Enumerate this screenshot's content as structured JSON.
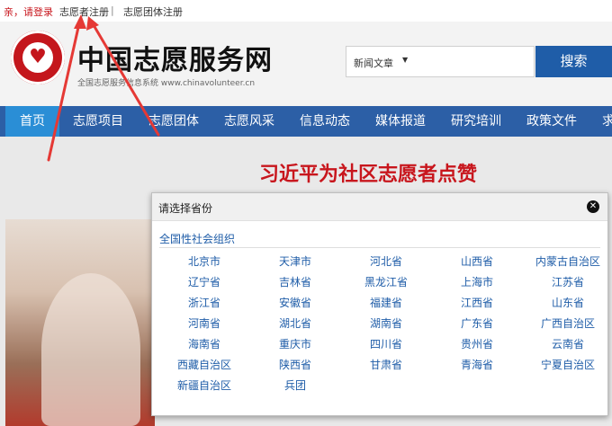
{
  "topbar": {
    "login_text": "亲，请登录",
    "volunteer_register": "志愿者注册",
    "separator": "|",
    "group_register": "志愿团体注册"
  },
  "header": {
    "site_title": "中国志愿服务网",
    "site_subtitle": "全国志愿服务信息系统 www.chinavolunteer.cn",
    "search_category": "新闻文章",
    "search_button": "搜索"
  },
  "nav": {
    "items": [
      "首页",
      "志愿项目",
      "志愿团体",
      "志愿风采",
      "信息动态",
      "媒体报道",
      "研究培训",
      "政策文件",
      "求"
    ]
  },
  "main": {
    "headline": "习近平为社区志愿者点赞"
  },
  "modal": {
    "title": "请选择省份",
    "national_link": "全国性社会组织",
    "provinces": [
      [
        "北京市",
        "天津市",
        "河北省",
        "山西省",
        "内蒙古自治区"
      ],
      [
        "辽宁省",
        "吉林省",
        "黑龙江省",
        "上海市",
        "江苏省"
      ],
      [
        "浙江省",
        "安徽省",
        "福建省",
        "江西省",
        "山东省"
      ],
      [
        "河南省",
        "湖北省",
        "湖南省",
        "广东省",
        "广西自治区"
      ],
      [
        "海南省",
        "重庆市",
        "四川省",
        "贵州省",
        "云南省"
      ],
      [
        "西藏自治区",
        "陕西省",
        "甘肃省",
        "青海省",
        "宁夏自治区"
      ],
      [
        "新疆自治区",
        "兵团"
      ]
    ]
  },
  "colors": {
    "brand_blue": "#2c5fa6",
    "active_blue": "#2a8ed6",
    "headline_red": "#c8161d",
    "link_blue": "#1f5da8",
    "annotation_red": "#e53935"
  }
}
